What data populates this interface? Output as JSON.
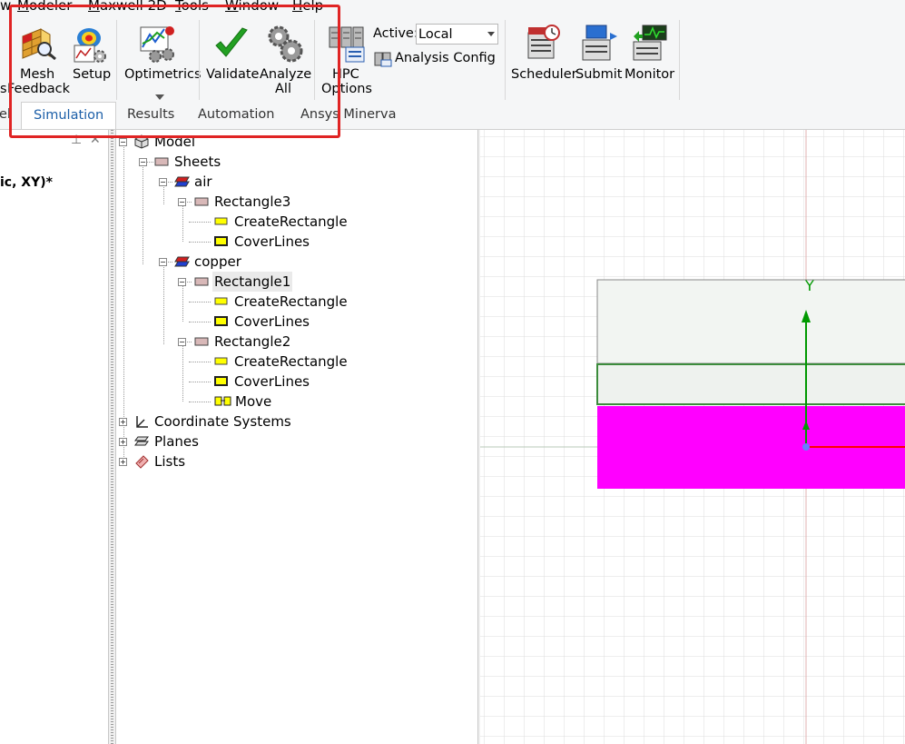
{
  "menu": [
    "w",
    "Modeler",
    "Maxwell 2D",
    "Tools",
    "Window",
    "Help"
  ],
  "ribbon": {
    "mesh_label_1": "Mesh",
    "mesh_label_2": "Feedback",
    "setup_label": "Setup",
    "optimetrics_label": "Optimetrics",
    "validate_label": "Validate",
    "analyze_label_1": "Analyze",
    "analyze_label_2": "All",
    "hpc_label_1": "HPC",
    "hpc_label_2": "Options",
    "active_label": "Active:",
    "active_value": "Local",
    "analysis_config_label": "Analysis Config",
    "scheduler_label": "Scheduler",
    "submit_label": "Submit",
    "monitor_label": "Monitor",
    "left_cut_1": "s"
  },
  "tabs": [
    "el",
    "Simulation",
    "Results",
    "Automation",
    "Ansys Minerva"
  ],
  "left_panel": {
    "title_fragment": "ic, XY)*",
    "pin_glyph": "⊥",
    "close_glyph": "✕"
  },
  "tree": {
    "model": "Model",
    "sheets": "Sheets",
    "air": "air",
    "rectangle3": "Rectangle3",
    "create_rect_1": "CreateRectangle",
    "cover_lines_1": "CoverLines",
    "copper": "copper",
    "rectangle1": "Rectangle1",
    "create_rect_2": "CreateRectangle",
    "cover_lines_2": "CoverLines",
    "rectangle2": "Rectangle2",
    "create_rect_3": "CreateRectangle",
    "cover_lines_3": "CoverLines",
    "move": "Move",
    "coord_systems": "Coordinate Systems",
    "planes": "Planes",
    "lists": "Lists"
  },
  "viewport": {
    "y_axis_label": "Y",
    "colors": {
      "air": "#f2f5f2",
      "copper": "#ff00ff",
      "y_axis": "#009900",
      "x_axis": "#ff0000"
    }
  }
}
